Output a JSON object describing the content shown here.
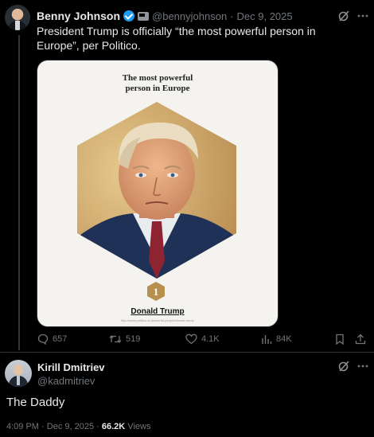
{
  "original_post": {
    "author_name": "Benny Johnson",
    "handle": "@bennyjohnson",
    "separator": "·",
    "date": "Dec 9, 2025",
    "text": "President Trump is officially “the most powerful person in Europe”, per Politico.",
    "media": {
      "title_line1": "The most powerful",
      "title_line2": "person in Europe",
      "rank": "1",
      "name": "Donald Trump",
      "small_print": "http://www.politico.eu/powerful-people/donald-trump"
    },
    "actions": {
      "replies": "657",
      "reposts": "519",
      "likes": "4.1K",
      "views": "84K"
    }
  },
  "reply": {
    "author_name": "Kirill Dmitriev",
    "handle": "@kadmitriev",
    "text": "The Daddy",
    "time": "4:09 PM",
    "separator": "·",
    "date": "Dec 9, 2025",
    "views_count": "66.2K",
    "views_label": "Views"
  },
  "colors": {
    "background": "#000000",
    "text": "#e7e9ea",
    "muted": "#71767b",
    "verified": "#1d9bf0",
    "border": "#2f3336"
  },
  "icons": [
    "verified-badge-icon",
    "government-badge-icon",
    "grok-icon",
    "reply-icon",
    "repost-icon",
    "like-icon",
    "views-icon",
    "bookmark-icon",
    "share-icon"
  ]
}
